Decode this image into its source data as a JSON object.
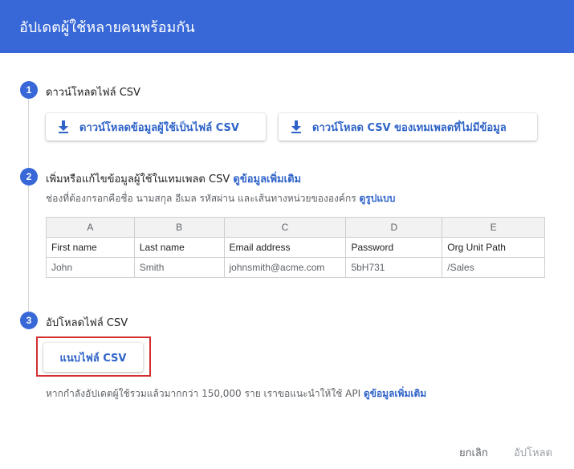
{
  "header": {
    "title": "อัปเดตผู้ใช้หลายคนพร้อมกัน"
  },
  "steps": [
    {
      "number": "1",
      "title": "ดาวน์โหลดไฟล์ CSV"
    },
    {
      "number": "2",
      "title": "เพิ่มหรือแก้ไขข้อมูลผู้ใช้ในเทมเพลต CSV",
      "link": "ดูข้อมูลเพิ่มเติม",
      "hint": "ช่องที่ต้องกรอกคือชื่อ นามสกุล อีเมล รหัสผ่าน และเส้นทางหน่วยขององค์กร",
      "hint_link": "ดูรูปแบบ"
    },
    {
      "number": "3",
      "title": "อัปโหลดไฟล์ CSV"
    }
  ],
  "downloads": {
    "users_csv": "ดาวน์โหลดข้อมูลผู้ใช้เป็นไฟล์ CSV",
    "blank_template": "ดาวน์โหลด CSV ของเทมเพลตที่ไม่มีข้อมูล",
    "icon": "download-icon"
  },
  "sheet": {
    "columns": [
      "A",
      "B",
      "C",
      "D",
      "E"
    ],
    "header": [
      "First name",
      "Last name",
      "Email address",
      "Password",
      "Org Unit Path"
    ],
    "rows": [
      [
        "John",
        "Smith",
        "johnsmith@acme.com",
        "5bH731",
        "/Sales"
      ]
    ]
  },
  "upload": {
    "attach_label": "แนบไฟล์ CSV",
    "note": "หากกำลังอัปเดตผู้ใช้รวมแล้วมากกว่า 150,000 ราย เราขอแนะนำให้ใช้ API",
    "note_link": "ดูข้อมูลเพิ่มเติม"
  },
  "footer": {
    "cancel": "ยกเลิก",
    "upload": "อัปโหลด"
  },
  "colors": {
    "accent": "#3868d7",
    "link": "#2f63c8",
    "highlight": "#d32f2f"
  }
}
